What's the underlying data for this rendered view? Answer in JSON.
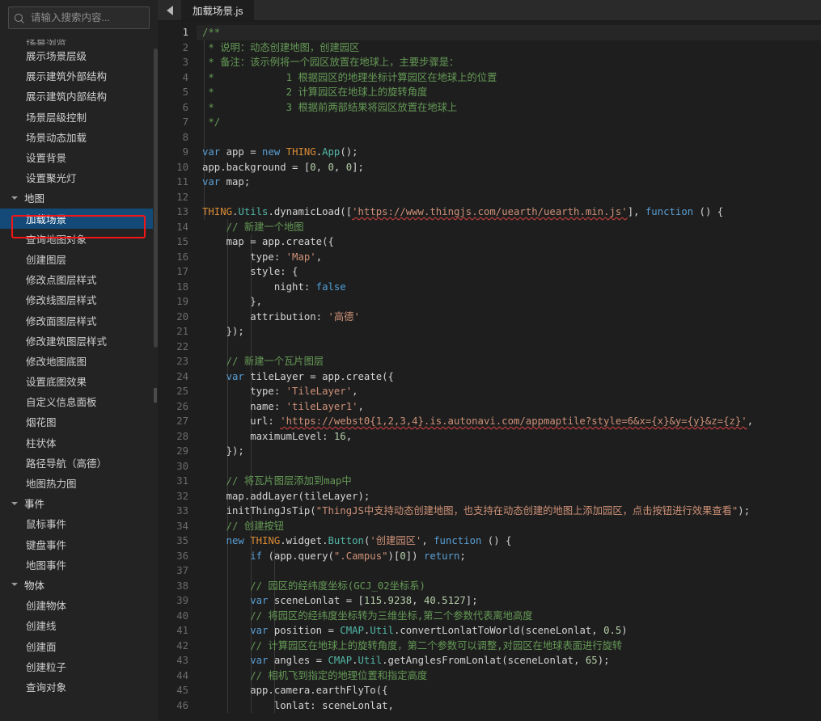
{
  "sidebar": {
    "search": {
      "placeholder": "请输入搜索内容...",
      "value": "",
      "icon": "search-icon"
    },
    "partial_top_item": "场景浏览",
    "items": [
      {
        "label": "展示场景层级",
        "type": "leaf"
      },
      {
        "label": "展示建筑外部结构",
        "type": "leaf"
      },
      {
        "label": "展示建筑内部结构",
        "type": "leaf"
      },
      {
        "label": "场景层级控制",
        "type": "leaf"
      },
      {
        "label": "场景动态加载",
        "type": "leaf"
      },
      {
        "label": "设置背景",
        "type": "leaf"
      },
      {
        "label": "设置聚光灯",
        "type": "leaf"
      },
      {
        "label": "地图",
        "type": "group",
        "expanded": true
      },
      {
        "label": "加载场景",
        "type": "leaf",
        "selected": true
      },
      {
        "label": "查询地图对象",
        "type": "leaf"
      },
      {
        "label": "创建图层",
        "type": "leaf"
      },
      {
        "label": "修改点图层样式",
        "type": "leaf"
      },
      {
        "label": "修改线图层样式",
        "type": "leaf"
      },
      {
        "label": "修改面图层样式",
        "type": "leaf"
      },
      {
        "label": "修改建筑图层样式",
        "type": "leaf"
      },
      {
        "label": "修改地图底图",
        "type": "leaf"
      },
      {
        "label": "设置底图效果",
        "type": "leaf"
      },
      {
        "label": "自定义信息面板",
        "type": "leaf"
      },
      {
        "label": "烟花图",
        "type": "leaf"
      },
      {
        "label": "柱状体",
        "type": "leaf"
      },
      {
        "label": "路径导航（高德）",
        "type": "leaf"
      },
      {
        "label": "地图热力图",
        "type": "leaf"
      },
      {
        "label": "事件",
        "type": "group",
        "expanded": true
      },
      {
        "label": "鼠标事件",
        "type": "leaf"
      },
      {
        "label": "键盘事件",
        "type": "leaf"
      },
      {
        "label": "地图事件",
        "type": "leaf"
      },
      {
        "label": "物体",
        "type": "group",
        "expanded": true
      },
      {
        "label": "创建物体",
        "type": "leaf"
      },
      {
        "label": "创建线",
        "type": "leaf"
      },
      {
        "label": "创建面",
        "type": "leaf"
      },
      {
        "label": "创建粒子",
        "type": "leaf"
      },
      {
        "label": "查询对象",
        "type": "leaf"
      }
    ],
    "selection_color": "#134a78",
    "annotation_color": "#f11717"
  },
  "editor": {
    "back_button": "back-arrow-icon",
    "tabs": [
      {
        "label": "加载场景.js",
        "active": true
      }
    ],
    "active_line": 1,
    "line_count_visible": 46,
    "code_lines": [
      {
        "n": 1,
        "segs": [
          {
            "t": "/**",
            "c": "tok-cmt"
          }
        ]
      },
      {
        "n": 2,
        "segs": [
          {
            "t": " * 说明：动态创建地图，创建园区",
            "c": "tok-cmt"
          }
        ]
      },
      {
        "n": 3,
        "segs": [
          {
            "t": " * 备注：该示例将一个园区放置在地球上，主要步骤是：",
            "c": "tok-cmt"
          }
        ]
      },
      {
        "n": 4,
        "segs": [
          {
            "t": " *            1 根据园区的地理坐标计算园区在地球上的位置",
            "c": "tok-cmt"
          }
        ]
      },
      {
        "n": 5,
        "segs": [
          {
            "t": " *            2 计算园区在地球上的旋转角度",
            "c": "tok-cmt"
          }
        ]
      },
      {
        "n": 6,
        "segs": [
          {
            "t": " *            3 根据前两部结果将园区放置在地球上",
            "c": "tok-cmt"
          }
        ]
      },
      {
        "n": 7,
        "segs": [
          {
            "t": " */",
            "c": "tok-cmt"
          }
        ]
      },
      {
        "n": 8,
        "segs": [
          {
            "t": "",
            "c": "tok-pln"
          }
        ]
      },
      {
        "n": 9,
        "segs": [
          {
            "t": "var",
            "c": "tok-kw"
          },
          {
            "t": " app = ",
            "c": "tok-pln"
          },
          {
            "t": "new",
            "c": "tok-kw"
          },
          {
            "t": " ",
            "c": "tok-pln"
          },
          {
            "t": "THING",
            "c": "tok-cls"
          },
          {
            "t": ".",
            "c": "tok-pln"
          },
          {
            "t": "App",
            "c": "tok-type"
          },
          {
            "t": "();",
            "c": "tok-pln"
          }
        ]
      },
      {
        "n": 10,
        "segs": [
          {
            "t": "app.background = [",
            "c": "tok-pln"
          },
          {
            "t": "0",
            "c": "tok-num"
          },
          {
            "t": ", ",
            "c": "tok-pln"
          },
          {
            "t": "0",
            "c": "tok-num"
          },
          {
            "t": ", ",
            "c": "tok-pln"
          },
          {
            "t": "0",
            "c": "tok-num"
          },
          {
            "t": "];",
            "c": "tok-pln"
          }
        ]
      },
      {
        "n": 11,
        "segs": [
          {
            "t": "var",
            "c": "tok-kw"
          },
          {
            "t": " map;",
            "c": "tok-pln"
          }
        ]
      },
      {
        "n": 12,
        "segs": [
          {
            "t": "",
            "c": "tok-pln"
          }
        ]
      },
      {
        "n": 13,
        "segs": [
          {
            "t": "THING",
            "c": "tok-cls"
          },
          {
            "t": ".",
            "c": "tok-pln"
          },
          {
            "t": "Utils",
            "c": "tok-type"
          },
          {
            "t": ".dynamicLoad([",
            "c": "tok-pln"
          },
          {
            "t": "'https://www.thingjs.com/uearth/uearth.min.js'",
            "c": "tok-url"
          },
          {
            "t": "], ",
            "c": "tok-pln"
          },
          {
            "t": "function",
            "c": "tok-kw"
          },
          {
            "t": " () {",
            "c": "tok-pln"
          }
        ]
      },
      {
        "n": 14,
        "segs": [
          {
            "t": "    // 新建一个地图",
            "c": "tok-cmt"
          }
        ]
      },
      {
        "n": 15,
        "segs": [
          {
            "t": "    map = app.create({",
            "c": "tok-pln"
          }
        ]
      },
      {
        "n": 16,
        "segs": [
          {
            "t": "        type: ",
            "c": "tok-pln"
          },
          {
            "t": "'Map'",
            "c": "tok-str"
          },
          {
            "t": ",",
            "c": "tok-pln"
          }
        ]
      },
      {
        "n": 17,
        "segs": [
          {
            "t": "        style: {",
            "c": "tok-pln"
          }
        ]
      },
      {
        "n": 18,
        "segs": [
          {
            "t": "            night: ",
            "c": "tok-pln"
          },
          {
            "t": "false",
            "c": "tok-kw2"
          }
        ]
      },
      {
        "n": 19,
        "segs": [
          {
            "t": "        },",
            "c": "tok-pln"
          }
        ]
      },
      {
        "n": 20,
        "segs": [
          {
            "t": "        attribution: ",
            "c": "tok-pln"
          },
          {
            "t": "'高德'",
            "c": "tok-str"
          }
        ]
      },
      {
        "n": 21,
        "segs": [
          {
            "t": "    });",
            "c": "tok-pln"
          }
        ]
      },
      {
        "n": 22,
        "segs": [
          {
            "t": "",
            "c": "tok-pln"
          }
        ]
      },
      {
        "n": 23,
        "segs": [
          {
            "t": "    // 新建一个瓦片图层",
            "c": "tok-cmt"
          }
        ]
      },
      {
        "n": 24,
        "segs": [
          {
            "t": "    ",
            "c": "tok-pln"
          },
          {
            "t": "var",
            "c": "tok-kw"
          },
          {
            "t": " tileLayer = app.create({",
            "c": "tok-pln"
          }
        ]
      },
      {
        "n": 25,
        "segs": [
          {
            "t": "        type: ",
            "c": "tok-pln"
          },
          {
            "t": "'TileLayer'",
            "c": "tok-str"
          },
          {
            "t": ",",
            "c": "tok-pln"
          }
        ]
      },
      {
        "n": 26,
        "segs": [
          {
            "t": "        name: ",
            "c": "tok-pln"
          },
          {
            "t": "'tileLayer1'",
            "c": "tok-str"
          },
          {
            "t": ",",
            "c": "tok-pln"
          }
        ]
      },
      {
        "n": 27,
        "segs": [
          {
            "t": "        url: ",
            "c": "tok-pln"
          },
          {
            "t": "'https://webst0{1,2,3,4}.is.autonavi.com/appmaptile?style=6&x={x}&y={y}&z={z}'",
            "c": "tok-url"
          },
          {
            "t": ",",
            "c": "tok-pln"
          }
        ]
      },
      {
        "n": 28,
        "segs": [
          {
            "t": "        maximumLevel: ",
            "c": "tok-pln"
          },
          {
            "t": "16",
            "c": "tok-num"
          },
          {
            "t": ",",
            "c": "tok-pln"
          }
        ]
      },
      {
        "n": 29,
        "segs": [
          {
            "t": "    });",
            "c": "tok-pln"
          }
        ]
      },
      {
        "n": 30,
        "segs": [
          {
            "t": "",
            "c": "tok-pln"
          }
        ]
      },
      {
        "n": 31,
        "segs": [
          {
            "t": "    // 将瓦片图层添加到map中",
            "c": "tok-cmt"
          }
        ]
      },
      {
        "n": 32,
        "segs": [
          {
            "t": "    map.addLayer(tileLayer);",
            "c": "tok-pln"
          }
        ]
      },
      {
        "n": 33,
        "segs": [
          {
            "t": "    initThingJsTip(",
            "c": "tok-pln"
          },
          {
            "t": "\"ThingJS中支持动态创建地图，也支持在动态创建的地图上添加园区，点击按钮进行效果查看\"",
            "c": "tok-str"
          },
          {
            "t": ");",
            "c": "tok-pln"
          }
        ]
      },
      {
        "n": 34,
        "segs": [
          {
            "t": "    // 创建按钮",
            "c": "tok-cmt"
          }
        ]
      },
      {
        "n": 35,
        "segs": [
          {
            "t": "    ",
            "c": "tok-pln"
          },
          {
            "t": "new",
            "c": "tok-kw"
          },
          {
            "t": " ",
            "c": "tok-pln"
          },
          {
            "t": "THING",
            "c": "tok-cls"
          },
          {
            "t": ".widget.",
            "c": "tok-pln"
          },
          {
            "t": "Button",
            "c": "tok-type"
          },
          {
            "t": "(",
            "c": "tok-pln"
          },
          {
            "t": "'创建园区'",
            "c": "tok-str"
          },
          {
            "t": ", ",
            "c": "tok-pln"
          },
          {
            "t": "function",
            "c": "tok-kw"
          },
          {
            "t": " () {",
            "c": "tok-pln"
          }
        ]
      },
      {
        "n": 36,
        "segs": [
          {
            "t": "        ",
            "c": "tok-pln"
          },
          {
            "t": "if",
            "c": "tok-kw"
          },
          {
            "t": " (app.query(",
            "c": "tok-pln"
          },
          {
            "t": "\".Campus\"",
            "c": "tok-str"
          },
          {
            "t": ")[",
            "c": "tok-pln"
          },
          {
            "t": "0",
            "c": "tok-num"
          },
          {
            "t": "]) ",
            "c": "tok-pln"
          },
          {
            "t": "return",
            "c": "tok-kw"
          },
          {
            "t": ";",
            "c": "tok-pln"
          }
        ]
      },
      {
        "n": 37,
        "segs": [
          {
            "t": "",
            "c": "tok-pln"
          }
        ]
      },
      {
        "n": 38,
        "segs": [
          {
            "t": "        // 园区的经纬度坐标(GCJ_02坐标系)",
            "c": "tok-cmt"
          }
        ]
      },
      {
        "n": 39,
        "segs": [
          {
            "t": "        ",
            "c": "tok-pln"
          },
          {
            "t": "var",
            "c": "tok-kw"
          },
          {
            "t": " sceneLonlat = [",
            "c": "tok-pln"
          },
          {
            "t": "115.9238",
            "c": "tok-num"
          },
          {
            "t": ", ",
            "c": "tok-pln"
          },
          {
            "t": "40.5127",
            "c": "tok-num"
          },
          {
            "t": "];",
            "c": "tok-pln"
          }
        ]
      },
      {
        "n": 40,
        "segs": [
          {
            "t": "        // 将园区的经纬度坐标转为三维坐标,第二个参数代表离地高度",
            "c": "tok-cmt"
          }
        ]
      },
      {
        "n": 41,
        "segs": [
          {
            "t": "        ",
            "c": "tok-pln"
          },
          {
            "t": "var",
            "c": "tok-kw"
          },
          {
            "t": " position = ",
            "c": "tok-pln"
          },
          {
            "t": "CMAP",
            "c": "tok-type"
          },
          {
            "t": ".",
            "c": "tok-pln"
          },
          {
            "t": "Util",
            "c": "tok-type"
          },
          {
            "t": ".convertLonlatToWorld(sceneLonlat, ",
            "c": "tok-pln"
          },
          {
            "t": "0.5",
            "c": "tok-num"
          },
          {
            "t": ")",
            "c": "tok-pln"
          }
        ]
      },
      {
        "n": 42,
        "segs": [
          {
            "t": "        // 计算园区在地球上的旋转角度，第二个参数可以调整,对园区在地球表面进行旋转",
            "c": "tok-cmt"
          }
        ]
      },
      {
        "n": 43,
        "segs": [
          {
            "t": "        ",
            "c": "tok-pln"
          },
          {
            "t": "var",
            "c": "tok-kw"
          },
          {
            "t": " angles = ",
            "c": "tok-pln"
          },
          {
            "t": "CMAP",
            "c": "tok-type"
          },
          {
            "t": ".",
            "c": "tok-pln"
          },
          {
            "t": "Util",
            "c": "tok-type"
          },
          {
            "t": ".getAnglesFromLonlat(sceneLonlat, ",
            "c": "tok-pln"
          },
          {
            "t": "65",
            "c": "tok-num"
          },
          {
            "t": ");",
            "c": "tok-pln"
          }
        ]
      },
      {
        "n": 44,
        "segs": [
          {
            "t": "        // 相机飞到指定的地理位置和指定高度",
            "c": "tok-cmt"
          }
        ]
      },
      {
        "n": 45,
        "segs": [
          {
            "t": "        app.camera.earthFlyTo({",
            "c": "tok-pln"
          }
        ]
      },
      {
        "n": 46,
        "segs": [
          {
            "t": "            lonlat: sceneLonlat,",
            "c": "tok-pln"
          }
        ]
      }
    ]
  },
  "theme": {
    "editor_bg": "#1e1e1e",
    "sidebar_bg": "#232323",
    "tabbar_bg": "#2a2a2a",
    "comment": "#659a56",
    "keyword": "#5a9fd4",
    "string": "#ce9178",
    "number": "#b5cea8",
    "class": "#d98b35",
    "type": "#52b7a6"
  }
}
